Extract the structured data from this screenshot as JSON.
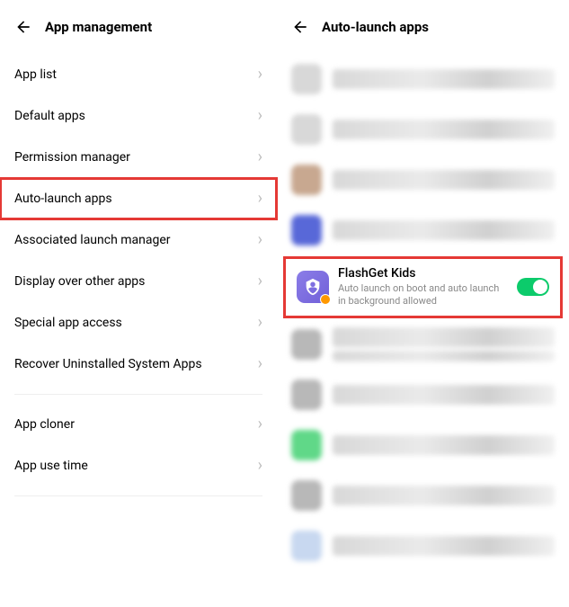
{
  "left": {
    "title": "App management",
    "items": [
      {
        "label": "App list"
      },
      {
        "label": "Default apps"
      },
      {
        "label": "Permission manager"
      },
      {
        "label": "Auto-launch apps"
      },
      {
        "label": "Associated launch manager"
      },
      {
        "label": "Display over other apps"
      },
      {
        "label": "Special app access"
      },
      {
        "label": "Recover Uninstalled System Apps"
      }
    ],
    "items2": [
      {
        "label": "App cloner"
      },
      {
        "label": "App use time"
      }
    ]
  },
  "right": {
    "title": "Auto-launch apps",
    "app": {
      "name": "FlashGet Kids",
      "sub": "Auto launch on boot and auto launch in background allowed"
    },
    "blur_colors": [
      "#d8d8d8",
      "#d8d8d8",
      "#c8a890",
      "#5868d8",
      "#8b7de8",
      "#b8b8b8",
      "#b8b8b8",
      "#60d888",
      "#b8b8b8",
      "#c8d8f0"
    ]
  }
}
